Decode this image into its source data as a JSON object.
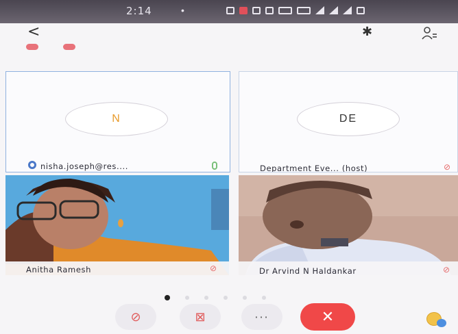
{
  "status_bar": {
    "time": "2:14",
    "separator": "•"
  },
  "toolbar": {
    "back_glyph": "<",
    "bluetooth_glyph": "✱"
  },
  "tiles": [
    {
      "avatar_initial": "N",
      "name": "nisha.joseph@res....",
      "muted": false
    },
    {
      "avatar_initial": "DE",
      "name": "Department Eve... (host)",
      "muted": true
    },
    {
      "name": "Anitha Ramesh",
      "muted": true
    },
    {
      "name": "Dr Arvind N Haldankar",
      "muted": true
    }
  ],
  "controls": {
    "mic_glyph": "⊘",
    "video_glyph": "⊠",
    "more_glyph": "···",
    "end_glyph": "✕"
  },
  "pager": {
    "pages": 6,
    "current": 1
  },
  "colors": {
    "end_call": "#f04848",
    "muted_icon": "#e66a6a",
    "active_border": "#8fb1e0",
    "avatar_orange": "#e89a2a"
  }
}
